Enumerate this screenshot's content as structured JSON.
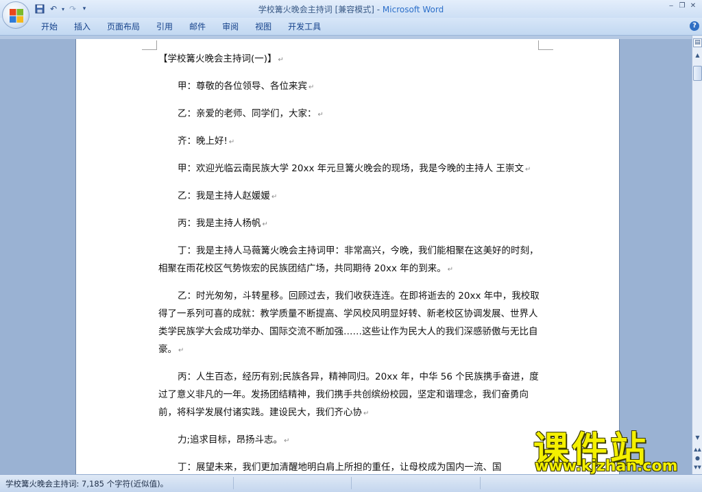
{
  "window": {
    "title": "学校篝火晚会主持词 [兼容模式] - ",
    "app_name": "Microsoft Word"
  },
  "qat": {
    "save_icon": "floppy-save-icon",
    "undo_icon": "undo-icon",
    "redo_icon": "redo-icon"
  },
  "ribbon": {
    "tabs": [
      "开始",
      "插入",
      "页面布局",
      "引用",
      "邮件",
      "审阅",
      "视图",
      "开发工具"
    ],
    "help": "?"
  },
  "document": {
    "heading": "【学校篝火晚会主持词(一)】",
    "paragraphs": [
      "甲：尊敬的各位领导、各位来宾",
      "乙：亲爱的老师、同学们，大家：",
      "齐：晚上好!",
      "甲：欢迎光临云南民族大学 20xx 年元旦篝火晚会的现场，我是今晚的主持人 王崇文",
      "乙：我是主持人赵媛媛",
      "丙：我是主持人杨帆",
      "丁：我是主持人马薇篝火晚会主持词甲：非常高兴，今晚，我们能相聚在这美好的时刻，相聚在雨花校区气势恢宏的民族团结广场，共同期待 20xx 年的到来。",
      "乙：时光匆匆，斗转星移。回顾过去，我们收获连连。在即将逝去的 20xx 年中，我校取得了一系列可喜的成就：教学质量不断提高、学风校风明显好转、新老校区协调发展、世界人类学民族学大会成功举办、国际交流不断加强……这些让作为民大人的我们深感骄傲与无比自豪。",
      "丙：人生百态，经历有别;民族各异，精神同归。20xx 年，中华 56 个民族携手奋进，度过了意义非凡的一年。发扬团结精神，我们携手共创缤纷校园，坚定和谐理念，我们奋勇向前，将科学发展付诸实践。建设民大，我们齐心协",
      "力;追求目标，昂扬斗志。",
      "丁：展望未来，我们更加清醒地明白肩上所担的重任，让母校成为国内一流、国"
    ],
    "para_mark": "↵"
  },
  "statusbar": {
    "text": "学校篝火晚会主持词: 7,185 个字符(近似值)。"
  },
  "watermark": {
    "title": "课件站",
    "url": "www.kjzhan.com"
  }
}
